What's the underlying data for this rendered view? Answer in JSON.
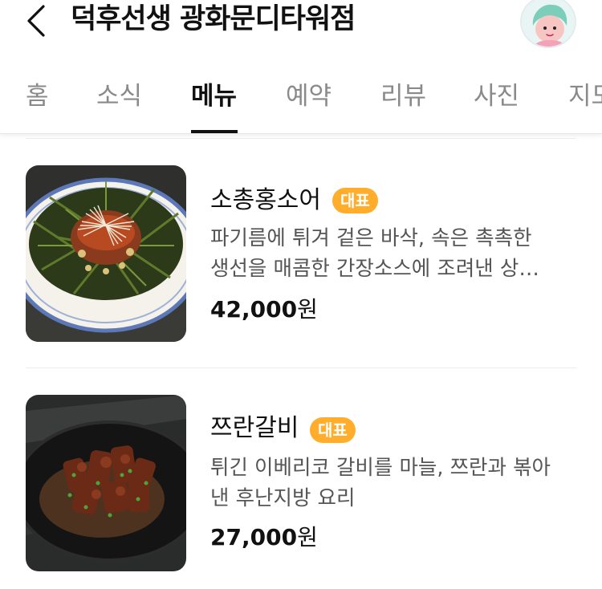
{
  "header": {
    "back_icon": "chevron-left-icon",
    "title": "덕후선생 광화문디타워점",
    "avatar_icon": "user-avatar-icon"
  },
  "tabs": [
    {
      "label": "홈",
      "active": false
    },
    {
      "label": "소식",
      "active": false
    },
    {
      "label": "메뉴",
      "active": true
    },
    {
      "label": "예약",
      "active": false
    },
    {
      "label": "리뷰",
      "active": false
    },
    {
      "label": "사진",
      "active": false
    },
    {
      "label": "지도",
      "active": false
    }
  ],
  "menu": {
    "items": [
      {
        "name": "소총홍소어",
        "badge": "대표",
        "desc_line1": "파기름에 튀겨 겉은 바삭, 속은 촉촉한",
        "desc_line2": "생선을 매콤한 간장소스에 조려낸 상…",
        "price": "42,000",
        "currency": "원"
      },
      {
        "name": "쯔란갈비",
        "badge": "대표",
        "desc_line1": "튀긴 이베리코 갈비를 마늘, 쯔란과 볶아",
        "desc_line2": "낸 후난지방 요리",
        "price": "27,000",
        "currency": "원"
      }
    ]
  },
  "colors": {
    "badge": "#ffad2a",
    "active_tab": "#111111",
    "inactive_tab": "#8a8a8a",
    "description": "#555555"
  }
}
